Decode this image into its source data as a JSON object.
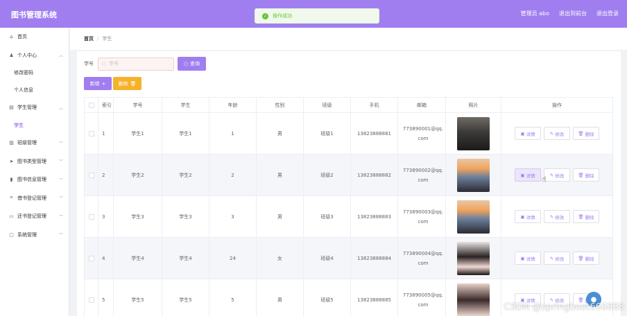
{
  "header": {
    "title": "图书管理系统",
    "admin_label": "管理员 abo",
    "back_to_front": "退出到前台",
    "logout": "退出登录",
    "accent_color": "#a07ef0"
  },
  "toast": {
    "text": "操作成功",
    "status": "success"
  },
  "sidebar": {
    "items": [
      {
        "label": "首页",
        "icon": "home-icon"
      },
      {
        "label": "个人中心",
        "icon": "user-icon",
        "expanded": true
      },
      {
        "label": "修改密码",
        "sub": true
      },
      {
        "label": "个人信息",
        "sub": true
      },
      {
        "label": "学生管理",
        "icon": "list-icon",
        "expanded": true
      },
      {
        "label": "学生",
        "sub": true,
        "active": true
      },
      {
        "label": "班级管理",
        "icon": "chart-icon"
      },
      {
        "label": "图书类型管理",
        "icon": "send-icon"
      },
      {
        "label": "图书信息管理",
        "icon": "bar-icon"
      },
      {
        "label": "借书登记管理",
        "icon": "crop-icon"
      },
      {
        "label": "还书登记管理",
        "icon": "box-icon"
      },
      {
        "label": "系统管理",
        "icon": "chat-icon"
      }
    ]
  },
  "breadcrumb": {
    "home": "首页",
    "current": "学生"
  },
  "search": {
    "label": "学号",
    "placeholder": "学号",
    "button": "查询"
  },
  "actions": {
    "add": "新增",
    "delete": "删除"
  },
  "table": {
    "headers": [
      "索引",
      "学号",
      "学生",
      "年龄",
      "性别",
      "班级",
      "手机",
      "邮箱",
      "照片",
      "操作"
    ],
    "row_actions": {
      "detail": "详情",
      "edit": "修改",
      "delete": "删除"
    },
    "rows": [
      {
        "index": "1",
        "student_no": "学生1",
        "name": "学生1",
        "age": "1",
        "gender": "男",
        "class": "班级1",
        "phone": "13823888881",
        "email": "773890001@qq.com",
        "photo": "man-portrait"
      },
      {
        "index": "2",
        "student_no": "学生2",
        "name": "学生2",
        "age": "2",
        "gender": "男",
        "class": "班级2",
        "phone": "13823888882",
        "email": "773890002@qq.com",
        "photo": "man-sunset"
      },
      {
        "index": "3",
        "student_no": "学生3",
        "name": "学生3",
        "age": "3",
        "gender": "男",
        "class": "班级3",
        "phone": "13823888883",
        "email": "773890003@qq.com",
        "photo": "man-sunset"
      },
      {
        "index": "4",
        "student_no": "学生4",
        "name": "学生4",
        "age": "24",
        "gender": "女",
        "class": "班级4",
        "phone": "13823888884",
        "email": "773890004@qq.com",
        "photo": "woman-portrait"
      },
      {
        "index": "5",
        "student_no": "学生5",
        "name": "学生5",
        "age": "5",
        "gender": "男",
        "class": "班级5",
        "phone": "13823888885",
        "email": "773890005@qq.com",
        "photo": "woman-portrait-2"
      }
    ]
  },
  "watermark": "CSDN @springboot666888"
}
